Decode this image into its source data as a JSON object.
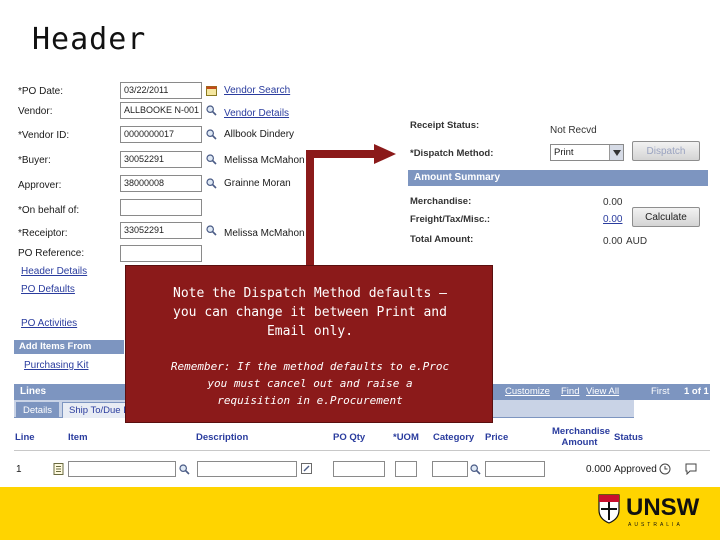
{
  "slide": {
    "title": "Header"
  },
  "form": {
    "po_date": {
      "label": "*PO Date:",
      "value": "03/22/2011"
    },
    "vendor": {
      "label": "Vendor:",
      "value": "ALLBOOKE N-001"
    },
    "vendor_id": {
      "label": "*Vendor ID:",
      "value": "0000000017",
      "name": "Allbook Dindery"
    },
    "buyer": {
      "label": "*Buyer:",
      "value": "30052291",
      "name": "Melissa McMahon"
    },
    "approver": {
      "label": "Approver:",
      "value": "38000008",
      "name": "Grainne Moran"
    },
    "on_behalf_of": {
      "label": "*On behalf of:",
      "value": ""
    },
    "receiptor": {
      "label": "*Receiptor:",
      "value": "33052291",
      "name": "Melissa McMahon"
    },
    "po_reference": {
      "label": "PO Reference:",
      "value": ""
    },
    "vendor_search_link": "Vendor Search",
    "vendor_details_link": "Vendor Details",
    "header_details_link": "Header Details",
    "po_defaults_link": "PO Defaults",
    "po_activities_link": "PO Activities",
    "add_items_from": "Add Items From",
    "purchasing_kit_link": "Purchasing Kit"
  },
  "summary": {
    "receipt_status_label": "Receipt Status:",
    "receipt_status_value": "Not Recvd",
    "dispatch_method_label": "*Dispatch Method:",
    "dispatch_method_value": "Print",
    "dispatch_button": "Dispatch",
    "amount_summary_title": "Amount Summary",
    "merchandise_label": "Merchandise:",
    "merchandise_value": "0.00",
    "freight_label": "Freight/Tax/Misc.:",
    "freight_value": "0.00",
    "total_label": "Total Amount:",
    "total_value": "0.00",
    "currency": "AUD",
    "calculate_button": "Calculate"
  },
  "lines": {
    "title": "Lines",
    "customize": "Customize",
    "find": "Find",
    "view_all": "View All",
    "first": "First",
    "page": "1 of 1",
    "tabs": [
      "Details",
      "Ship To/Due Date"
    ],
    "columns": {
      "line": "Line",
      "item": "Item",
      "description": "Description",
      "po_qty": "PO Qty",
      "uom": "*UOM",
      "category": "Category",
      "price": "Price",
      "merch_amount": "Merchandise Amount",
      "status": "Status"
    },
    "row": {
      "line": "1",
      "amount": "0.000",
      "status": "Approved"
    }
  },
  "callout": {
    "main_lines": [
      "Note the Dispatch Method defaults –",
      "you can change it between Print and",
      "Email only."
    ],
    "note_lines": [
      "Remember: If the method defaults to e.Proc",
      "you must cancel out and raise a",
      "requisition in e.Procurement"
    ]
  },
  "brand": {
    "name": "UNSW",
    "sub": "AUSTRALIA"
  },
  "colors": {
    "callout": "#8b1a1a",
    "footer": "#ffd400",
    "bar": "#7d95c0",
    "link": "#2a3c9e"
  }
}
